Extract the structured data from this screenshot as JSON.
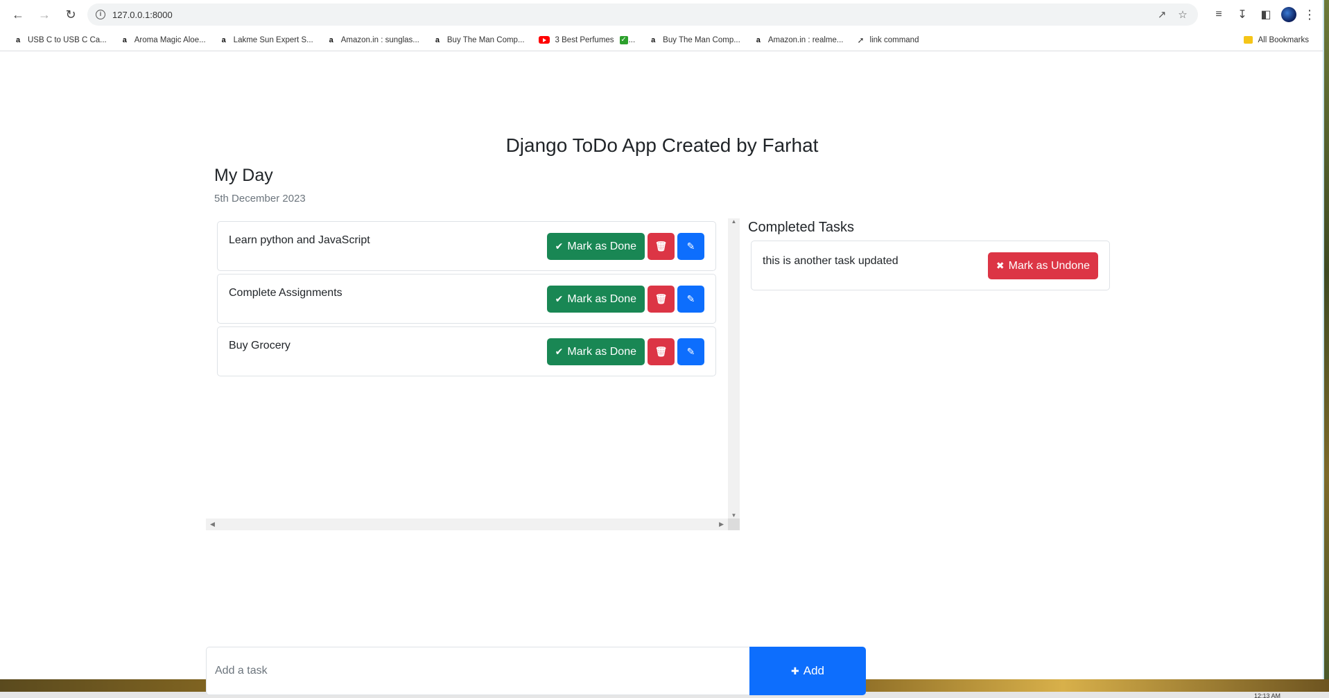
{
  "browser": {
    "url": "127.0.0.1:8000",
    "bookmarks": [
      {
        "label": "USB C to USB C Ca...",
        "icon": "amazon-icon"
      },
      {
        "label": "Aroma Magic Aloe...",
        "icon": "amazon-icon"
      },
      {
        "label": "Lakme Sun Expert S...",
        "icon": "amazon-icon"
      },
      {
        "label": "Amazon.in : sunglas...",
        "icon": "amazon-icon"
      },
      {
        "label": "Buy The Man Comp...",
        "icon": "amazon-icon"
      },
      {
        "label": "3 Best Perfumes",
        "suffix": "...",
        "icon": "youtube-icon"
      },
      {
        "label": "Buy The Man Comp...",
        "icon": "amazon-icon"
      },
      {
        "label": "Amazon.in : realme...",
        "icon": "amazon-icon"
      },
      {
        "label": "link command",
        "icon": "link-icon"
      }
    ],
    "all_bookmarks": "All Bookmarks"
  },
  "app": {
    "title": "Django ToDo App Created by Farhat",
    "day_title": "My Day",
    "date": "5th December 2023"
  },
  "tasks": [
    {
      "text": "Learn python and JavaScript",
      "done_label": "Mark as Done"
    },
    {
      "text": "Complete Assignments",
      "done_label": "Mark as Done"
    },
    {
      "text": "Buy Grocery",
      "done_label": "Mark as Done"
    }
  ],
  "completed": {
    "title": "Completed Tasks",
    "items": [
      {
        "text": "this is another task updated",
        "undone_label": "Mark as Undone"
      }
    ]
  },
  "add_form": {
    "placeholder": "Add a task",
    "button_label": "Add"
  },
  "taskbar": {
    "clock": "12:13 AM"
  },
  "colors": {
    "success": "#198754",
    "danger": "#dc3545",
    "primary": "#0d6efd"
  }
}
